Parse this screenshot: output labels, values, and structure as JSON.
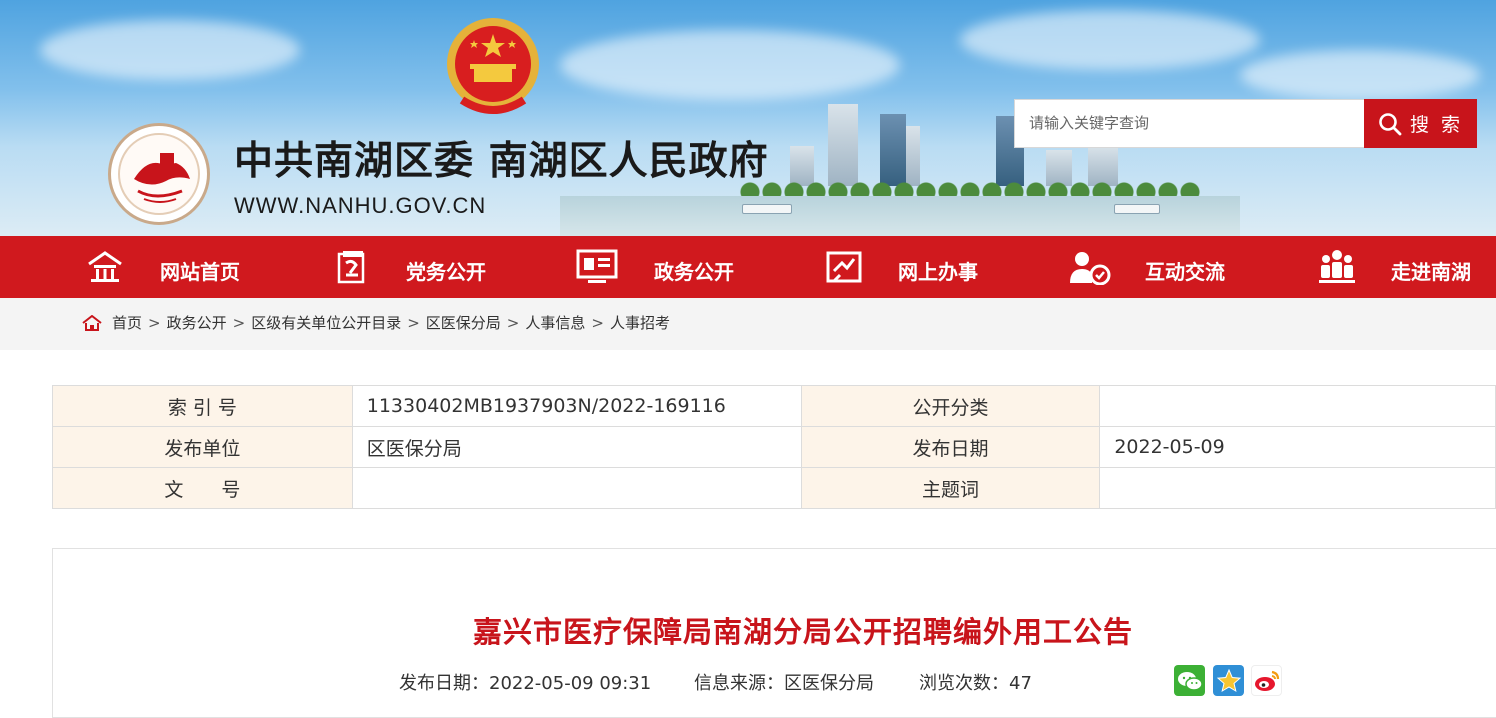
{
  "header": {
    "site_title": "中共南湖区委 南湖区人民政府",
    "site_url": "WWW.NANHU.GOV.CN",
    "search_placeholder": "请输入关键字查询",
    "search_button": "搜 索"
  },
  "nav": {
    "items": [
      {
        "label": "网站首页",
        "icon": "home-icon"
      },
      {
        "label": "党务公开",
        "icon": "party-flag-icon"
      },
      {
        "label": "政务公开",
        "icon": "document-screen-icon"
      },
      {
        "label": "网上办事",
        "icon": "online-service-icon"
      },
      {
        "label": "互动交流",
        "icon": "interaction-icon"
      },
      {
        "label": "走进南湖",
        "icon": "people-group-icon"
      }
    ]
  },
  "breadcrumb": {
    "separator": ">",
    "items": [
      "首页",
      "政务公开",
      "区级有关单位公开目录",
      "区医保分局",
      "人事信息",
      "人事招考"
    ]
  },
  "meta_table": {
    "rows": [
      {
        "k1": "索 引 号",
        "v1": "11330402MB1937903N/2022-169116",
        "k2": "公开分类",
        "v2": ""
      },
      {
        "k1": "发布单位",
        "v1": "区医保分局",
        "k2": "发布日期",
        "v2": "2022-05-09"
      },
      {
        "k1": "文　　号",
        "v1": "",
        "k2": "主题词",
        "v2": ""
      }
    ]
  },
  "article": {
    "title": "嘉兴市医疗保障局南湖分局公开招聘编外用工公告",
    "publish_date": "发布日期：2022-05-09 09:31",
    "source": "信息来源：区医保分局",
    "views": "浏览次数：47"
  },
  "share": {
    "icons": [
      "wechat-icon",
      "qzone-star-icon",
      "weibo-icon"
    ]
  },
  "colors": {
    "primary_red": "#d0191e",
    "title_red": "#c8141b",
    "meta_label_bg": "#fdf4e9"
  }
}
